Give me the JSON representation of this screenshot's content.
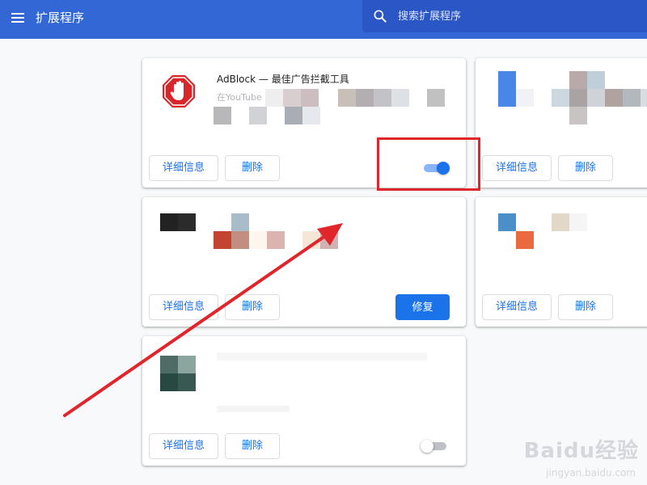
{
  "header": {
    "title": "扩展程序",
    "search_placeholder": "搜索扩展程序"
  },
  "buttons": {
    "details": "详细信息",
    "remove": "删除",
    "repair": "修复"
  },
  "extensions": [
    {
      "name": "AdBlock — 最佳广告拦截工具",
      "description_fragment": "在YouTube",
      "enabled": true,
      "icon": "adblock-stop-hand-icon"
    },
    {
      "name": "",
      "enabled": null
    },
    {
      "name": "",
      "has_repair": true
    },
    {
      "name": "",
      "enabled": null
    },
    {
      "name": "",
      "enabled": false
    }
  ],
  "watermark": {
    "brand": "Baidu经验",
    "url": "jingyan.baidu.com"
  },
  "colors": {
    "topbar": "#3367d6",
    "accent": "#1a73e8",
    "highlight": "#e0262b",
    "adblock_red": "#d9262b"
  }
}
